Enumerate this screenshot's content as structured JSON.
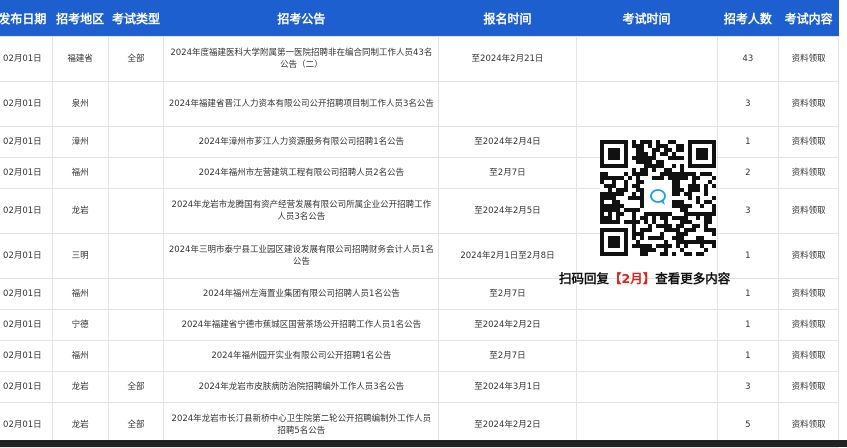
{
  "headers": [
    "发布日期",
    "招考地区",
    "考试类型",
    "招考公告",
    "报名时间",
    "考试时间",
    "招考人数",
    "考试内容"
  ],
  "rows": [
    {
      "date": "02月01日",
      "region": "福建省",
      "type": "全部",
      "title": "2024年度福建医科大学附属第一医院招聘非在编合同制工作人员43名公告（二）",
      "signup": "至2024年2月21日",
      "exam": "",
      "count": "43",
      "content": "资料领取"
    },
    {
      "date": "02月01日",
      "region": "泉州",
      "type": "",
      "title": "2024年福建省晋江人力资本有限公司公开招聘项目制工作人员3名公告",
      "signup": "",
      "exam": "",
      "count": "3",
      "content": "资料领取"
    },
    {
      "date": "02月01日",
      "region": "漳州",
      "type": "",
      "title": "2024年漳州市芗江人力资源服务有限公司招聘1名公告",
      "signup": "至2024年2月4日",
      "exam": "",
      "count": "1",
      "content": "资料领取"
    },
    {
      "date": "02月01日",
      "region": "福州",
      "type": "",
      "title": "2024年福州市左营建筑工程有限公司招聘人员2名公告",
      "signup": "至2月7日",
      "exam": "",
      "count": "2",
      "content": "资料领取"
    },
    {
      "date": "02月01日",
      "region": "龙岩",
      "type": "",
      "title": "2024年龙岩市龙腾国有资产经营发展有限公司所属企业公开招聘工作人员3名公告",
      "signup": "至2024年2月5日",
      "exam": "",
      "count": "3",
      "content": "资料领取"
    },
    {
      "date": "02月01日",
      "region": "三明",
      "type": "",
      "title": "2024年三明市泰宁县工业园区建设发展有限公司招聘财务会计人员1名公告",
      "signup": "2024年2月1日至2月8日",
      "exam": "",
      "count": "1",
      "content": "资料领取"
    },
    {
      "date": "02月01日",
      "region": "福州",
      "type": "",
      "title": "2024年福州左海置业集团有限公司招聘人员1名公告",
      "signup": "至2月7日",
      "exam": "",
      "count": "1",
      "content": "资料领取"
    },
    {
      "date": "02月01日",
      "region": "宁德",
      "type": "",
      "title": "2024年福建省宁德市蕉城区国营茶场公开招聘工作人员1名公告",
      "signup": "至2024年2月2日",
      "exam": "",
      "count": "1",
      "content": "资料领取"
    },
    {
      "date": "02月01日",
      "region": "福州",
      "type": "",
      "title": "2024年福州园开实业有限公司公开招聘1名公告",
      "signup": "至2月7日",
      "exam": "",
      "count": "1",
      "content": "资料领取"
    },
    {
      "date": "02月01日",
      "region": "龙岩",
      "type": "全部",
      "title": "2024年龙岩市皮肤病防治院招聘编外工作人员3名公告",
      "signup": "至2024年3月1日",
      "exam": "",
      "count": "3",
      "content": "资料领取"
    },
    {
      "date": "02月01日",
      "region": "龙岩",
      "type": "全部",
      "title": "2024年龙岩市长汀县新桥中心卫生院第二轮公开招聘编制外工作人员招聘5名公告",
      "signup": "至2024年2月2日",
      "exam": "",
      "count": "5",
      "content": "资料领取"
    }
  ],
  "qr": {
    "caption_prefix": "扫码回复",
    "caption_highlight": "【2月】",
    "caption_suffix": "查看更多内容",
    "center_icon": "chat-bubble-icon"
  },
  "colors": {
    "header_bg": "#1e5fcf",
    "highlight": "#e0201b"
  }
}
